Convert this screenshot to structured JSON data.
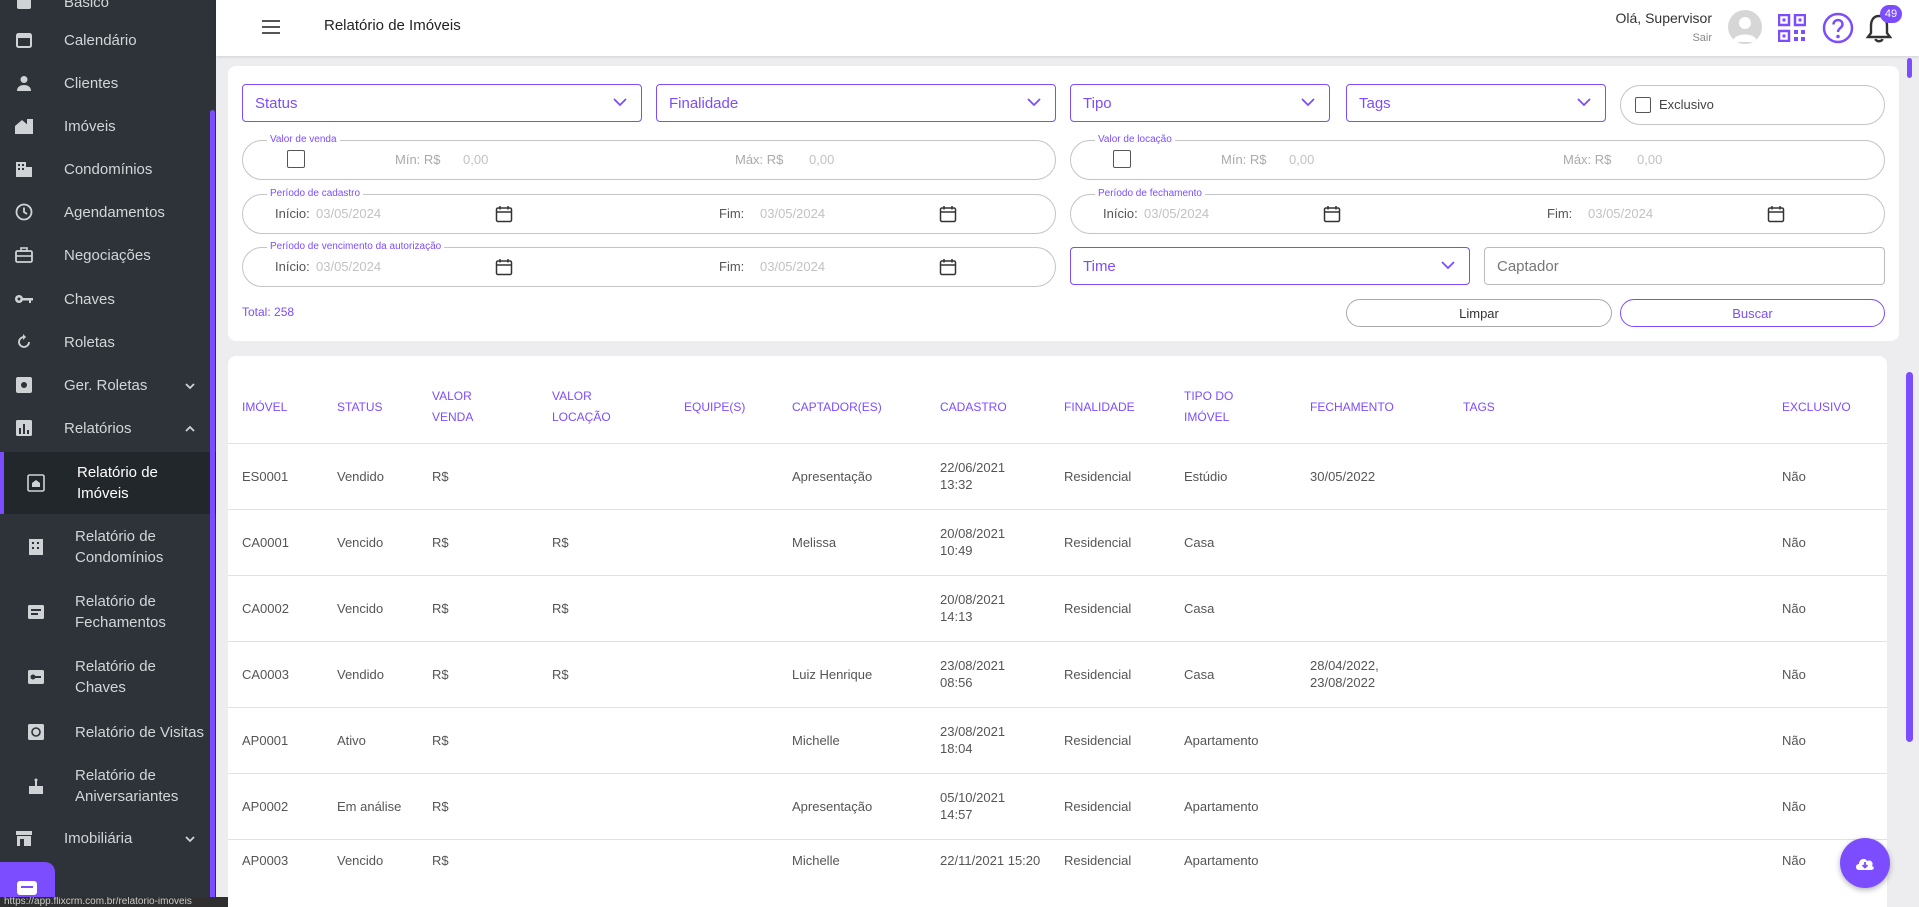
{
  "header": {
    "page_title": "Relatório de Imóveis",
    "greeting": "Olá, Supervisor",
    "signout": "Sair",
    "notification_count": "49"
  },
  "sidebar": {
    "items": [
      {
        "label": "Básico",
        "icon": "dashboard-icon"
      },
      {
        "label": "Calendário",
        "icon": "calendar-icon"
      },
      {
        "label": "Clientes",
        "icon": "person-icon"
      },
      {
        "label": "Imóveis",
        "icon": "house-icon"
      },
      {
        "label": "Condomínios",
        "icon": "building-icon"
      },
      {
        "label": "Agendamentos",
        "icon": "clock-icon"
      },
      {
        "label": "Negociações",
        "icon": "briefcase-icon"
      },
      {
        "label": "Chaves",
        "icon": "key-icon"
      },
      {
        "label": "Roletas",
        "icon": "refresh-icon"
      },
      {
        "label": "Ger. Roletas",
        "icon": "settings-icon"
      },
      {
        "label": "Relatórios",
        "icon": "bar-chart-icon"
      },
      {
        "label": "Relatório de Imóveis",
        "icon": "report-house-icon"
      },
      {
        "label": "Relatório de Condomínios",
        "icon": "report-building-icon"
      },
      {
        "label": "Relatório de Fechamentos",
        "icon": "report-closing-icon"
      },
      {
        "label": "Relatório de Chaves",
        "icon": "report-key-icon"
      },
      {
        "label": "Relatório de Visitas",
        "icon": "report-visit-icon"
      },
      {
        "label": "Relatório de Aniversariantes",
        "icon": "cake-icon"
      },
      {
        "label": "Imobiliária",
        "icon": "store-icon"
      }
    ],
    "status_url": "https://app.flixcrm.com.br/relatorio-imoveis"
  },
  "filters": {
    "status": "Status",
    "finalidade": "Finalidade",
    "tipo": "Tipo",
    "tags": "Tags",
    "exclusivo": "Exclusivo",
    "valor_venda": {
      "legend": "Valor de venda",
      "min_label": "Mín: R$",
      "min_ph": "0,00",
      "max_label": "Máx: R$",
      "max_ph": "0,00"
    },
    "valor_locacao": {
      "legend": "Valor de locação",
      "min_label": "Mín: R$",
      "min_ph": "0,00",
      "max_label": "Máx: R$",
      "max_ph": "0,00"
    },
    "periodo_cadastro": {
      "legend": "Período de cadastro",
      "inicio_label": "Início:",
      "inicio_value": "03/05/2024",
      "fim_label": "Fim:",
      "fim_value": "03/05/2024"
    },
    "periodo_fechamento": {
      "legend": "Período de fechamento",
      "inicio_label": "Início:",
      "inicio_value": "03/05/2024",
      "fim_label": "Fim:",
      "fim_value": "03/05/2024"
    },
    "periodo_vencimento": {
      "legend": "Período de vencimento da autorização",
      "inicio_label": "Início:",
      "inicio_value": "03/05/2024",
      "fim_label": "Fim:",
      "fim_value": "03/05/2024"
    },
    "time": "Time",
    "captador_ph": "Captador",
    "total": "Total: 258",
    "limpar": "Limpar",
    "buscar": "Buscar"
  },
  "table": {
    "headers": {
      "imovel": "IMÓVEL",
      "status": "STATUS",
      "valor_venda": "VALOR VENDA",
      "valor_locacao": "VALOR LOCAÇÃO",
      "equipes": "EQUIPE(S)",
      "captadores": "CAPTADOR(ES)",
      "cadastro": "CADASTRO",
      "finalidade": "FINALIDADE",
      "tipo": "TIPO DO IMÓVEL",
      "fechamento": "FECHAMENTO",
      "tags": "TAGS",
      "exclusivo": "EXCLUSIVO"
    },
    "rows": [
      {
        "imovel": "ES0001",
        "status": "Vendido",
        "valor_venda": "R$",
        "valor_locacao": "",
        "captador": "Apresentação",
        "cadastro": "22/06/2021 13:32",
        "finalidade": "Residencial",
        "tipo": "Estúdio",
        "fechamento": "30/05/2022",
        "exclusivo": "Não"
      },
      {
        "imovel": "CA0001",
        "status": "Vencido",
        "valor_venda": "R$",
        "valor_locacao": "R$",
        "captador": "Melissa",
        "cadastro": "20/08/2021 10:49",
        "finalidade": "Residencial",
        "tipo": "Casa",
        "fechamento": "",
        "exclusivo": "Não"
      },
      {
        "imovel": "CA0002",
        "status": "Vencido",
        "valor_venda": "R$",
        "valor_locacao": "R$",
        "captador": "",
        "cadastro": "20/08/2021 14:13",
        "finalidade": "Residencial",
        "tipo": "Casa",
        "fechamento": "",
        "exclusivo": "Não"
      },
      {
        "imovel": "CA0003",
        "status": "Vendido",
        "valor_venda": "R$",
        "valor_locacao": "R$",
        "captador": "Luiz Henrique",
        "cadastro": "23/08/2021 08:56",
        "finalidade": "Residencial",
        "tipo": "Casa",
        "fechamento": "28/04/2022, 23/08/2022",
        "exclusivo": "Não"
      },
      {
        "imovel": "AP0001",
        "status": "Ativo",
        "valor_venda": "R$",
        "valor_locacao": "",
        "captador": "Michelle",
        "cadastro": "23/08/2021 18:04",
        "finalidade": "Residencial",
        "tipo": "Apartamento",
        "fechamento": "",
        "exclusivo": "Não"
      },
      {
        "imovel": "AP0002",
        "status": "Em análise",
        "valor_venda": "R$",
        "valor_locacao": "",
        "captador": "Apresentação",
        "cadastro": "05/10/2021 14:57",
        "finalidade": "Residencial",
        "tipo": "Apartamento",
        "fechamento": "",
        "exclusivo": "Não"
      },
      {
        "imovel": "AP0003",
        "status": "Vencido",
        "valor_venda": "R$",
        "valor_locacao": "",
        "captador": "Michelle",
        "cadastro": "22/11/2021 15:20",
        "finalidade": "Residencial",
        "tipo": "Apartamento",
        "fechamento": "",
        "exclusivo": "Não"
      }
    ]
  }
}
